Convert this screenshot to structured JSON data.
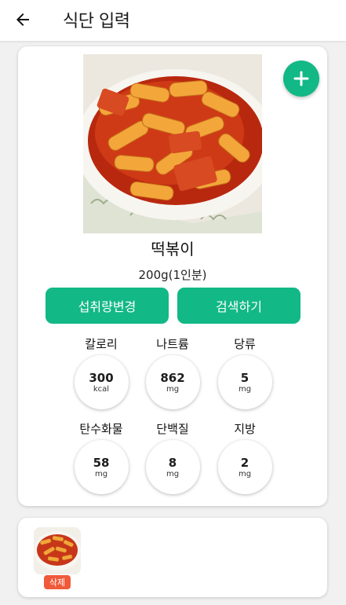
{
  "header": {
    "title": "식단 입력",
    "back_icon": "arrow-left-icon"
  },
  "food": {
    "name": "떡볶이",
    "serving": "200g(1인분)",
    "add_icon": "plus-icon"
  },
  "buttons": {
    "change_intake": "섭취량변경",
    "search": "검색하기"
  },
  "nutrients": [
    {
      "label": "칼로리",
      "value": "300",
      "unit": "kcal"
    },
    {
      "label": "나트륨",
      "value": "862",
      "unit": "mg"
    },
    {
      "label": "당류",
      "value": "5",
      "unit": "mg"
    },
    {
      "label": "탄수화물",
      "value": "58",
      "unit": "mg"
    },
    {
      "label": "단백질",
      "value": "8",
      "unit": "mg"
    },
    {
      "label": "지방",
      "value": "2",
      "unit": "mg"
    }
  ],
  "selected_items": {
    "delete_label": "삭제"
  },
  "colors": {
    "accent": "#12b886",
    "delete": "#f05a3a"
  }
}
